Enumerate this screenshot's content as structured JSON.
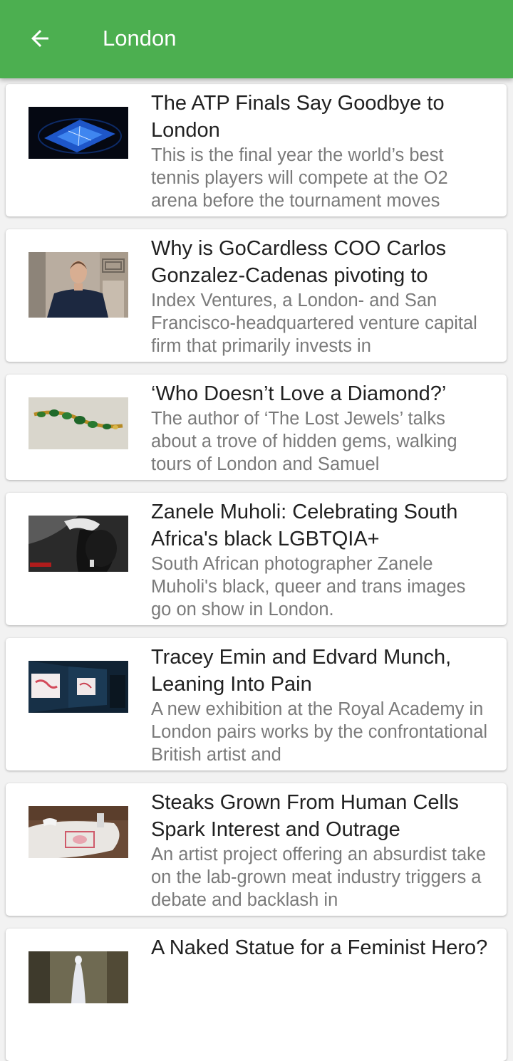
{
  "appbar": {
    "title": "London",
    "back_icon": "arrow-back-icon",
    "background": "#4caf50"
  },
  "articles": [
    {
      "title": "The ATP Finals Say Goodbye to London",
      "description": "This is the final year the world’s best tennis players will compete at the O2 arena before the tournament moves",
      "thumbnail": "tennis-arena-image"
    },
    {
      "title": "Why is GoCardless COO Carlos Gonzalez-Cadenas pivoting to",
      "description": "Index Ventures, a London- and San Francisco-headquartered venture capital firm that primarily invests in",
      "thumbnail": "man-portrait-image"
    },
    {
      "title": "‘Who Doesn’t Love a Diamond?’",
      "description": "The author of ‘The Lost Jewels’ talks about a trove of hidden gems, walking tours of London and Samuel",
      "thumbnail": "emerald-brooch-image"
    },
    {
      "title": "Zanele Muholi: Celebrating South Africa's black LGBTQIA+",
      "description": "South African photographer Zanele Muholi's black, queer and trans images go on show in London.",
      "thumbnail": "portrait-photograph-image"
    },
    {
      "title": "Tracey Emin and Edvard Munch, Leaning Into Pain",
      "description": "A new exhibition at the Royal Academy in London pairs works by the confrontational British artist and",
      "thumbnail": "gallery-room-image"
    },
    {
      "title": "Steaks Grown From Human Cells Spark Interest and Outrage",
      "description": "An artist project offering an absurdist take on the lab-grown meat industry triggers a debate and backlash in",
      "thumbnail": "art-installation-image"
    },
    {
      "title": "A Naked Statue for a Feminist Hero?",
      "description": "",
      "thumbnail": "statue-park-image"
    }
  ]
}
